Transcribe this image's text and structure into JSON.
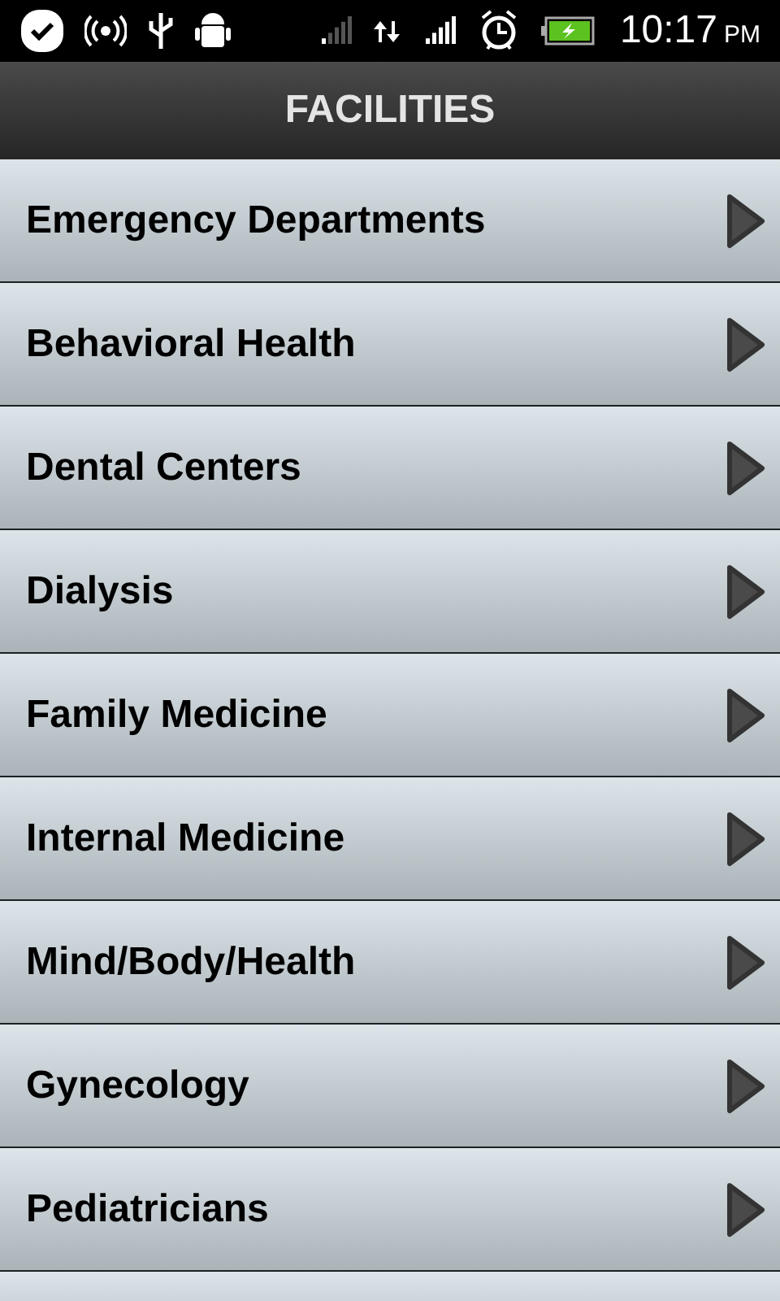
{
  "status_bar": {
    "time": "10:17",
    "period": "PM"
  },
  "header": {
    "title": "FACILITIES"
  },
  "items": [
    {
      "label": "Emergency Departments"
    },
    {
      "label": "Behavioral Health"
    },
    {
      "label": "Dental Centers"
    },
    {
      "label": "Dialysis"
    },
    {
      "label": "Family Medicine"
    },
    {
      "label": "Internal Medicine"
    },
    {
      "label": "Mind/Body/Health"
    },
    {
      "label": "Gynecology"
    },
    {
      "label": "Pediatricians"
    }
  ]
}
